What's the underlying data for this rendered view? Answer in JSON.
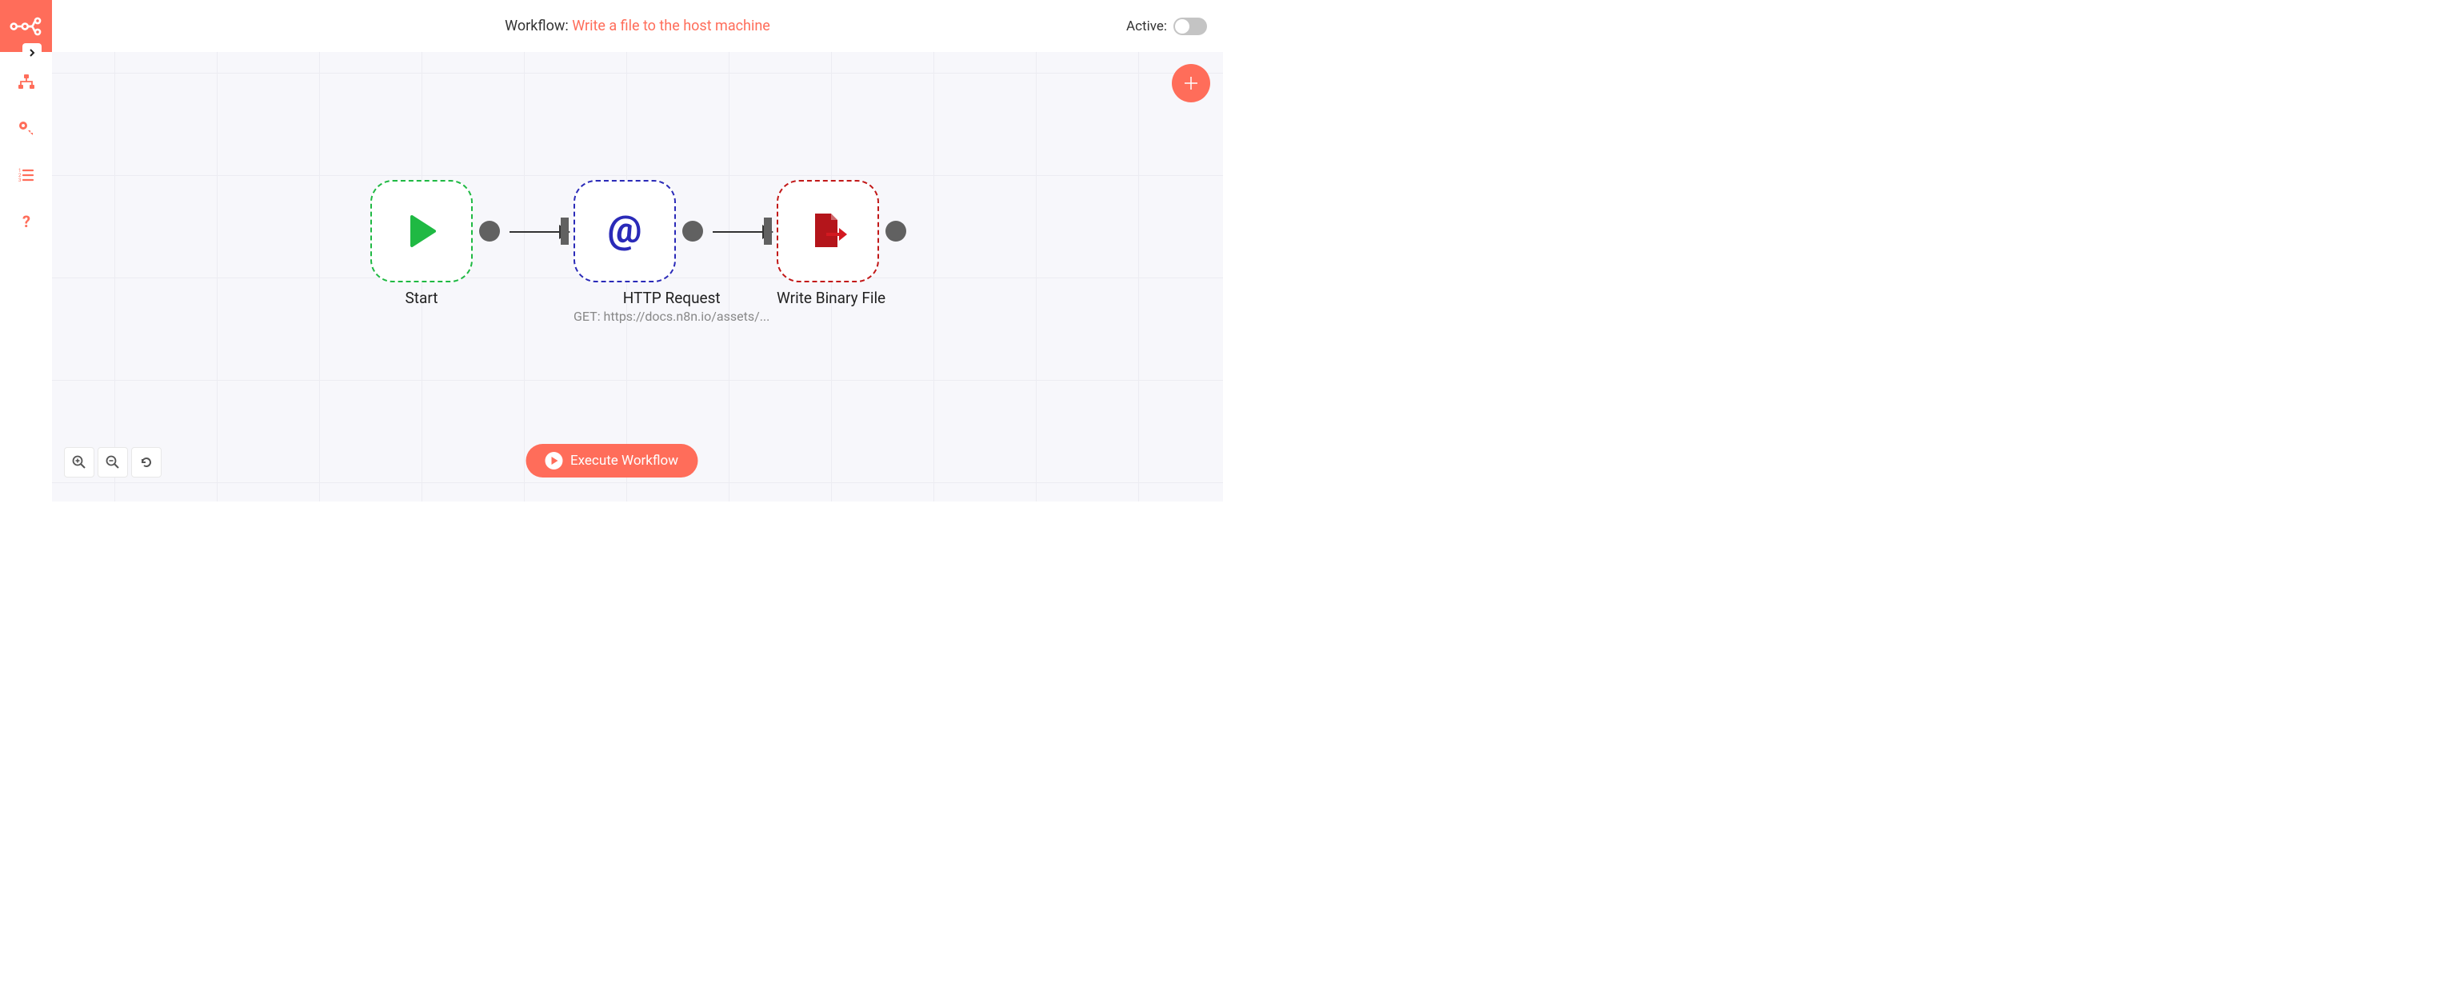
{
  "header": {
    "workflow_prefix": "Workflow: ",
    "workflow_name": "Write a file to the host machine",
    "active_label": "Active:"
  },
  "nodes": {
    "start": {
      "label": "Start"
    },
    "http": {
      "label": "HTTP Request",
      "sublabel": "GET: https://docs.n8n.io/assets/..."
    },
    "write": {
      "label": "Write Binary File"
    }
  },
  "buttons": {
    "execute": "Execute Workflow"
  },
  "colors": {
    "accent": "#ff6d5a"
  }
}
